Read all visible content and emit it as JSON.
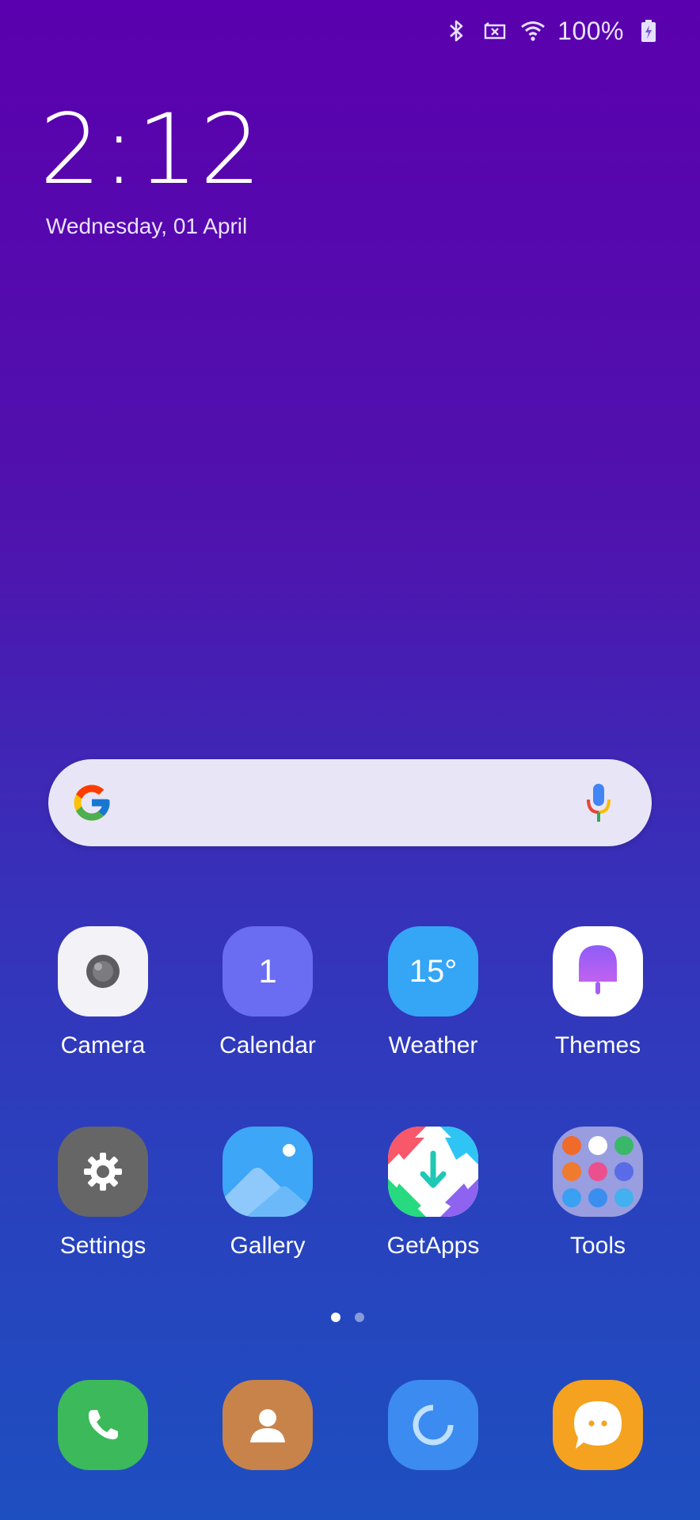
{
  "status": {
    "battery_pct": "100%"
  },
  "lockclock": {
    "time": "2:12",
    "date": "Wednesday, 01 April"
  },
  "apps_row1": [
    {
      "label": "Camera"
    },
    {
      "label": "Calendar",
      "badge": "1"
    },
    {
      "label": "Weather",
      "temp": "15°"
    },
    {
      "label": "Themes"
    }
  ],
  "apps_row2": [
    {
      "label": "Settings"
    },
    {
      "label": "Gallery"
    },
    {
      "label": "GetApps"
    },
    {
      "label": "Tools"
    }
  ],
  "colors": {
    "camera_bg": "#f3f2f7",
    "calendar_bg": "#6a6df1",
    "weather_bg": "#35a5f6",
    "themes_bg": "#ffffff",
    "settings_bg": "#666666",
    "gallery_bg": "#3da6f7",
    "phone_bg": "#3cb95a",
    "contacts_bg": "#c8834a",
    "browser_bg": "#3c8bf0",
    "messages_bg": "#f4a21f"
  },
  "page_indicator": {
    "pages": 2,
    "current": 1
  }
}
